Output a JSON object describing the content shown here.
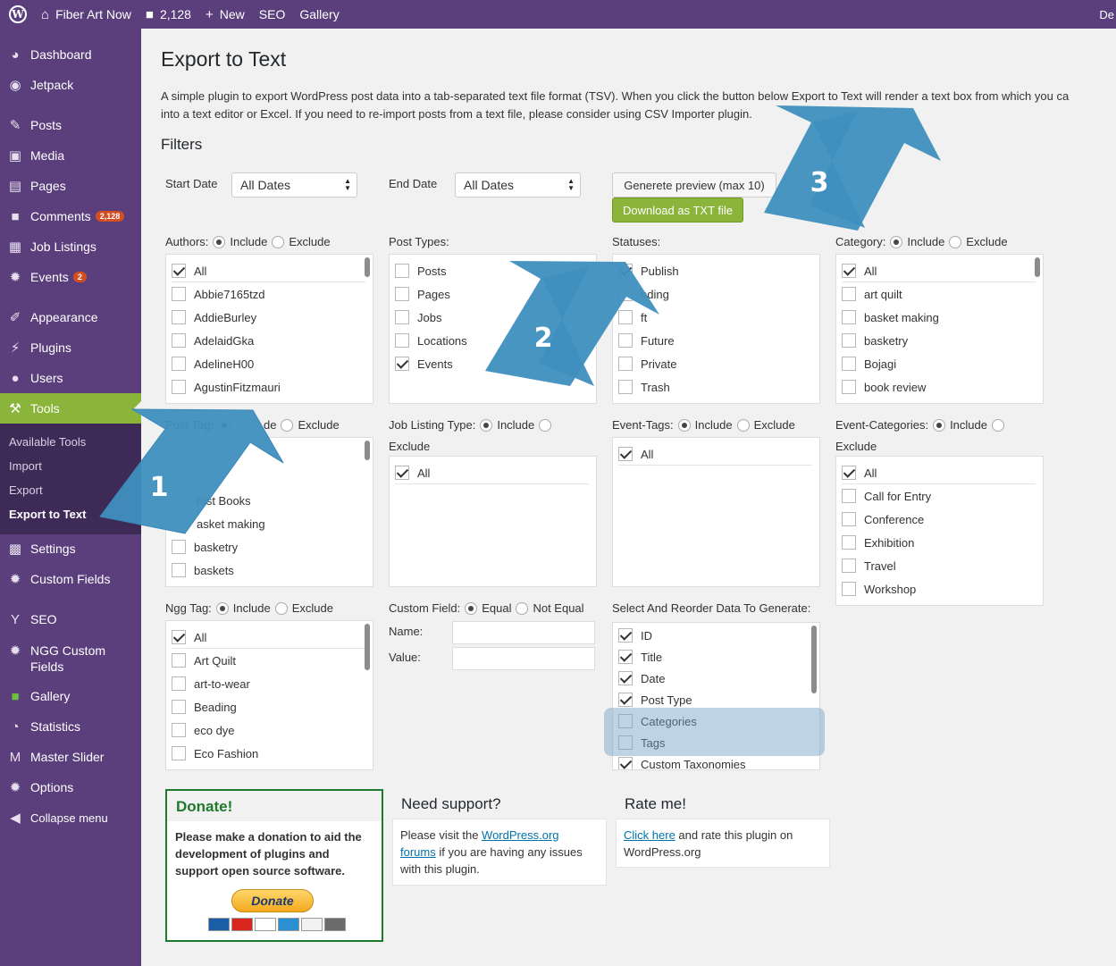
{
  "adminbar": {
    "site_name": "Fiber Art Now",
    "comments_count": "2,128",
    "new_label": "New",
    "seo_label": "SEO",
    "gallery_label": "Gallery",
    "right_text": "De"
  },
  "sidebar": {
    "items": [
      {
        "label": "Dashboard",
        "icon": "dashboard-icon"
      },
      {
        "label": "Jetpack",
        "icon": "jetpack-icon"
      },
      {
        "label": "Posts",
        "icon": "pin-icon"
      },
      {
        "label": "Media",
        "icon": "media-icon"
      },
      {
        "label": "Pages",
        "icon": "pages-icon"
      },
      {
        "label": "Comments",
        "icon": "comment-icon",
        "badge": "2,128"
      },
      {
        "label": "Job Listings",
        "icon": "briefcase-icon"
      },
      {
        "label": "Events",
        "icon": "gear-icon",
        "badge": "2"
      },
      {
        "label": "Appearance",
        "icon": "brush-icon"
      },
      {
        "label": "Plugins",
        "icon": "plug-icon"
      },
      {
        "label": "Users",
        "icon": "user-icon"
      },
      {
        "label": "Tools",
        "icon": "wrench-icon"
      },
      {
        "label": "Settings",
        "icon": "settings-icon"
      },
      {
        "label": "Custom Fields",
        "icon": "gear-icon"
      },
      {
        "label": "SEO",
        "icon": "yoast-icon"
      },
      {
        "label": "NGG Custom",
        "label2": "Fields",
        "icon": "gear-icon"
      },
      {
        "label": "Gallery",
        "icon": "gallery-icon"
      },
      {
        "label": "Statistics",
        "icon": "pie-chart-icon"
      },
      {
        "label": "Master Slider",
        "icon": "slider-icon"
      },
      {
        "label": "Options",
        "icon": "gear-icon"
      },
      {
        "label": "Collapse menu",
        "icon": "collapse-icon"
      }
    ],
    "submenu": [
      "Available Tools",
      "Import",
      "Export",
      "Export to Text"
    ]
  },
  "page": {
    "title": "Export to Text",
    "desc_line1": "A simple plugin to export WordPress post data into a tab-separated text file format (TSV). When you click the button below Export to Text will render a text box from which you ca",
    "desc_line2": "into a text editor or Excel. If you need to re-import posts from a text file, please consider using CSV Importer plugin.",
    "filters_heading": "Filters"
  },
  "dates": {
    "start_label": "Start Date",
    "start_value": "All Dates",
    "end_label": "End Date",
    "end_value": "All Dates"
  },
  "buttons": {
    "preview": "Generete preview (max 10)",
    "download": "Download as TXT file"
  },
  "filters": {
    "include": "Include",
    "exclude": "Exclude",
    "authors_label": "Authors:",
    "authors": [
      "All",
      "Abbie7165tzd",
      "AddieBurley",
      "AdelaidGka",
      "AdelineH00",
      "AgustinFitzmauri"
    ],
    "post_types_label": "Post Types:",
    "post_types": [
      "Posts",
      "Pages",
      "Jobs",
      "Locations",
      "Events"
    ],
    "statuses_label": "Statuses:",
    "statuses": [
      "Publish",
      "Pending",
      "Draft",
      "Future",
      "Private",
      "Trash"
    ],
    "statuses_visible": [
      "Publish",
      "nding",
      "ft",
      "Future",
      "Private",
      "Trash"
    ],
    "category_label": "Category:",
    "categories": [
      "All",
      "art quilt",
      "basket making",
      "basketry",
      "Bojagi",
      "book review"
    ],
    "post_tag_label": "Post Tag:",
    "post_tag_visible": [
      "rtist Books",
      "asket making",
      "basketry",
      "baskets"
    ],
    "post_tag_exclude_fragment": "de",
    "job_listing_label": "Job Listing Type:",
    "job_listing": [
      "All"
    ],
    "event_tags_label": "Event-Tags:",
    "event_tags": [
      "All"
    ],
    "event_categories_label": "Event-Categories:",
    "event_categories": [
      "All",
      "Call for Entry",
      "Conference",
      "Exhibition",
      "Travel",
      "Workshop"
    ],
    "ngg_tag_label": "Ngg Tag:",
    "ngg_tags": [
      "All",
      "Art Quilt",
      "art-to-wear",
      "Beading",
      "eco dye",
      "Eco Fashion"
    ],
    "custom_field_label": "Custom Field:",
    "equal": "Equal",
    "not_equal": "Not Equal",
    "name_label": "Name:",
    "value_label": "Value:",
    "reorder_label": "Select And Reorder Data To Generate:",
    "reorder_fields": [
      "ID",
      "Title",
      "Date",
      "Post Type",
      "Categories",
      "Tags",
      "Custom Taxonomies"
    ]
  },
  "bottom": {
    "donate_title": "Donate!",
    "donate_text_1": "Please make a donation to aid the",
    "donate_text_2": "development of plugins and",
    "donate_text_3": "support open source software.",
    "donate_button": "Donate",
    "support_title": "Need support?",
    "support_text_1": "Please visit the ",
    "support_link_1": "WordPress.org",
    "support_link_2": "forums",
    "support_text_2": " if you are having any issues",
    "support_text_3": "with this plugin.",
    "rate_title": "Rate me!",
    "rate_link": "Click here",
    "rate_text_1": " and rate this plugin on",
    "rate_text_2": "WordPress.org"
  },
  "annotations": [
    "1",
    "2",
    "3"
  ],
  "colors": {
    "admin_purple": "#5b3f7c",
    "active_green": "#8ab43a",
    "arrow_blue": "#3f8fbf",
    "highlight": "#9fc0d6"
  }
}
